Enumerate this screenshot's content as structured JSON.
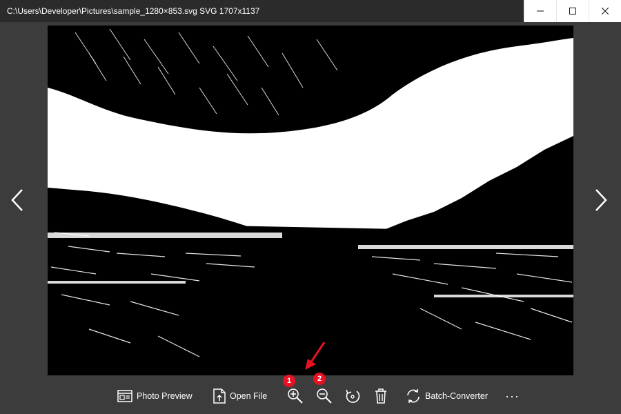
{
  "window": {
    "title": "C:\\Users\\Developer\\Pictures\\sample_1280×853.svg SVG 1707x1137"
  },
  "viewer": {
    "image_description": "black and white photo"
  },
  "toolbar": {
    "photo_preview_label": "Photo Preview",
    "open_file_label": "Open File",
    "batch_converter_label": "Batch-Converter",
    "more_label": "···"
  },
  "annotations": {
    "badge_1": "1",
    "badge_2": "2",
    "badge_color": "#e81123"
  }
}
